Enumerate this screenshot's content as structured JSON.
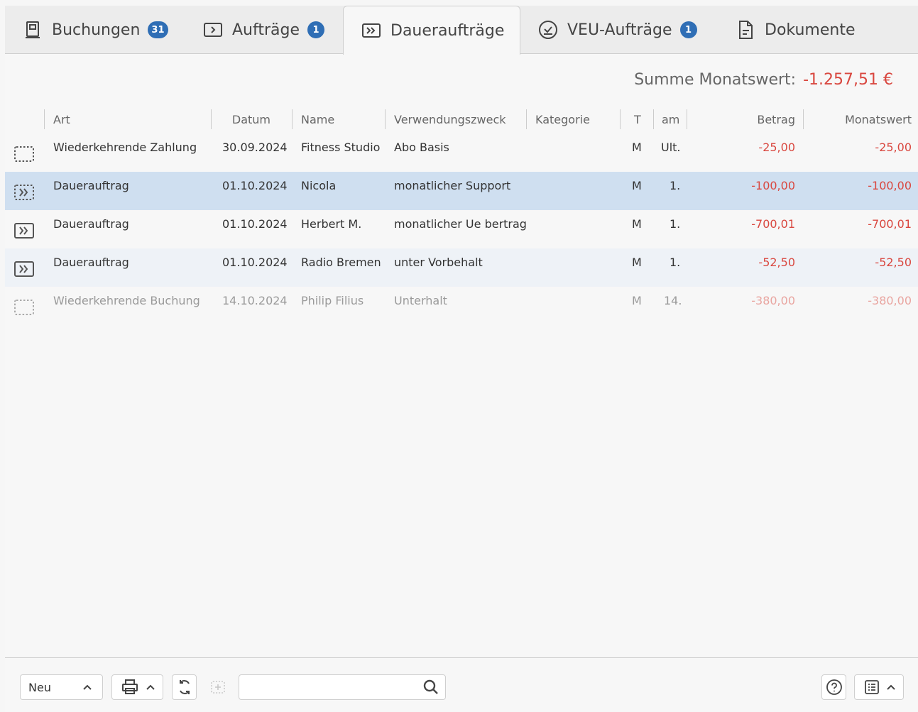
{
  "tabs": [
    {
      "label": "Buchungen",
      "badge": "31",
      "icon": "book-icon"
    },
    {
      "label": "Aufträge",
      "badge": "1",
      "icon": "transfer-icon"
    },
    {
      "label": "Daueraufträge",
      "badge": null,
      "icon": "standing-order-icon",
      "active": true
    },
    {
      "label": "VEU-Aufträge",
      "badge": "1",
      "icon": "check-circle-icon"
    },
    {
      "label": "Dokumente",
      "badge": null,
      "icon": "document-icon"
    }
  ],
  "summary": {
    "label": "Summe Monatswert:",
    "value": "-1.257,51 €"
  },
  "columns": {
    "art": "Art",
    "datum": "Datum",
    "name": "Name",
    "zweck": "Verwendungszweck",
    "kategorie": "Kategorie",
    "t": "T",
    "am": "am",
    "betrag": "Betrag",
    "monatswert": "Monatswert"
  },
  "rows": [
    {
      "art": "Wiederkehrende Zahlung",
      "datum": "30.09.2024",
      "name": "Fitness Studio",
      "zweck": "Abo Basis",
      "kategorie": "",
      "t": "M",
      "am": "Ult.",
      "betrag": "-25,00",
      "monatswert": "-25,00"
    },
    {
      "art": "Dauerauftrag",
      "datum": "01.10.2024",
      "name": "Nicola",
      "zweck": "monatlicher Support",
      "kategorie": "",
      "t": "M",
      "am": "1.",
      "betrag": "-100,00",
      "monatswert": "-100,00"
    },
    {
      "art": "Dauerauftrag",
      "datum": "01.10.2024",
      "name": "Herbert M.",
      "zweck": "monatlicher Ue bertrag",
      "kategorie": "",
      "t": "M",
      "am": "1.",
      "betrag": "-700,01",
      "monatswert": "-700,01"
    },
    {
      "art": "Dauerauftrag",
      "datum": "01.10.2024",
      "name": "Radio Bremen",
      "zweck": "unter Vorbehalt",
      "kategorie": "",
      "t": "M",
      "am": "1.",
      "betrag": "-52,50",
      "monatswert": "-52,50"
    },
    {
      "art": "Wiederkehrende Buchung",
      "datum": "14.10.2024",
      "name": "Philip Filius",
      "zweck": "Unterhalt",
      "kategorie": "",
      "t": "M",
      "am": "14.",
      "betrag": "-380,00",
      "monatswert": "-380,00"
    }
  ],
  "toolbar": {
    "new_label": "Neu",
    "search_placeholder": ""
  }
}
